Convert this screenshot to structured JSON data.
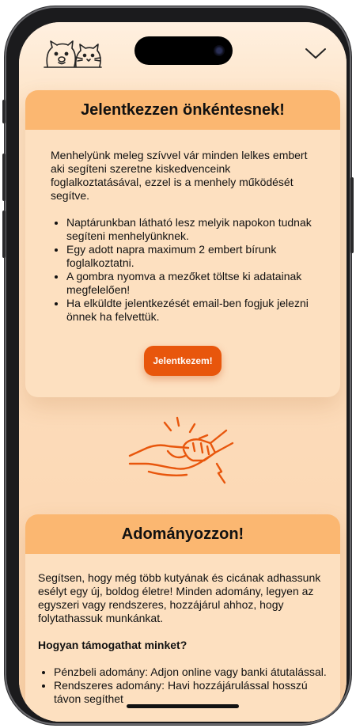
{
  "header": {
    "logo_icon": "dog-cat-logo-icon",
    "menu_icon": "chevron-down-icon"
  },
  "volunteer": {
    "title": "Jelentkezzen önkéntesnek!",
    "intro": "Menhelyünk meleg szívvel vár minden lelkes embert aki segíteni szeretne kiskedvenceink foglalkoztatásával, ezzel is a menhely működését segítve.",
    "bullets": [
      "Naptárunkban látható lesz melyik napokon tudnak segíteni menhelyünknek.",
      "Egy adott napra maximum 2 embert bírunk foglalkoztatni.",
      "A gombra nyomva a mezőket töltse ki adatainak megfelelően!",
      "Ha elküldte jelentkezését email-ben fogjuk jelezni önnek ha felvettük."
    ],
    "button_label": "Jelentkezem!"
  },
  "illustration": {
    "icon": "fist-bump-hands-icon"
  },
  "donate": {
    "title": "Adományozzon!",
    "intro": "Segítsen, hogy még több kutyának és cicának adhassunk esélyt egy új, boldog életre! Minden adomány, legyen az egyszeri vagy rendszeres, hozzájárul ahhoz, hogy folytathassuk munkánkat.",
    "subheading": "Hogyan támogathat minket?",
    "bullets": [
      "Pénzbeli adomány: Adjon online vagy banki átutalással.",
      "Rendszeres adomány: Havi hozzájárulással hosszú távon segíthet"
    ]
  },
  "colors": {
    "header_band": "#fbb771",
    "card_bg": "#fde0c0",
    "accent": "#e8560c",
    "page_bg": "#fde2c4"
  }
}
